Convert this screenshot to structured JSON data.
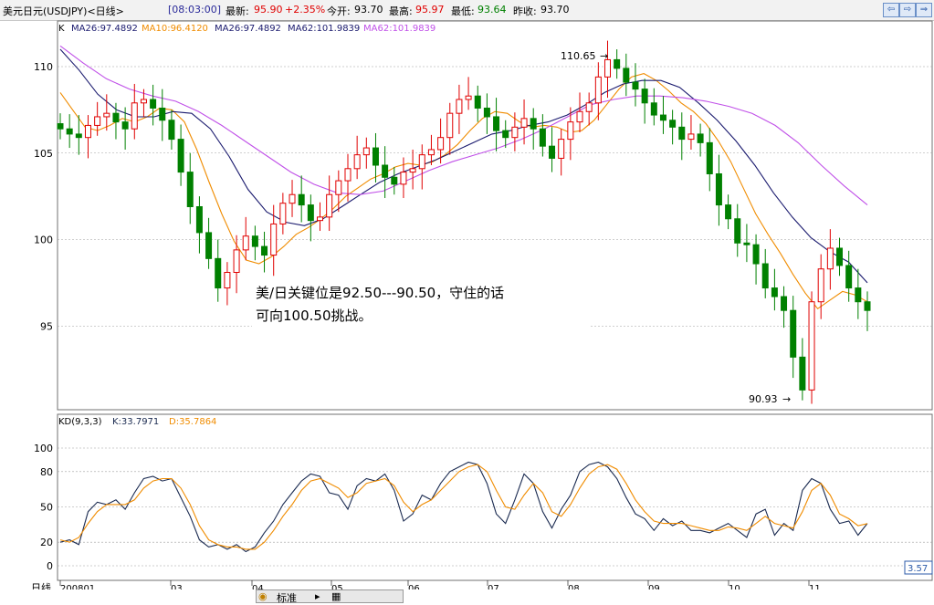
{
  "header": {
    "instrument": "美元日元(USDJPY)<日线>",
    "time": "[08:03:00]",
    "latest_label": "最新:",
    "latest_value": "95.90",
    "change_pct": "+2.35%",
    "open_label": "今开:",
    "open_value": "93.70",
    "high_label": "最高:",
    "high_value": "95.97",
    "low_label": "最低:",
    "low_value": "93.64",
    "prev_close_label": "昨收:",
    "prev_close_value": "93.70"
  },
  "main_legend": {
    "k": "K",
    "ma26_a": "MA26:97.4892",
    "ma10": "MA10:96.4120",
    "ma26_b": "MA26:97.4892",
    "ma62_a": "MA62:101.9839",
    "ma62_b": "MA62:101.9839"
  },
  "kd_legend": {
    "title": "KD(9,3,3)",
    "k": "K:33.7971",
    "d": "D:35.7864"
  },
  "annotation": {
    "line1": "美/日关键位是92.50---90.50，守住的话",
    "line2": "可向100.50挑战。"
  },
  "price_markers": {
    "high": "110.65",
    "low": "90.93"
  },
  "price_ticks": [
    "110",
    "105",
    "100",
    "95"
  ],
  "kd_ticks": [
    "100",
    "80",
    "50",
    "20",
    "0"
  ],
  "x_axis": {
    "label": "日线",
    "months": [
      "200801",
      "03",
      "04",
      "05",
      "06",
      "07",
      "08",
      "09",
      "10",
      "11"
    ]
  },
  "kd_readout": "3.57",
  "bottom": {
    "label": "标准"
  },
  "colors": {
    "up": "#e00000",
    "down": "#008000",
    "ma10": "#f08c00",
    "ma26": "#1a1a6e",
    "ma62": "#c050e8",
    "k": "#1a2a50",
    "d": "#f08c00",
    "grid": "#a0a0a0",
    "accent_blue": "#2b5aa8"
  },
  "icons": [
    "nav-left-icon",
    "nav-right-icon",
    "nav-forward-icon"
  ],
  "chart_data": {
    "type": "candlestick",
    "title": "美元日元(USDJPY)<日线>",
    "xlabel": "日线",
    "ylim": [
      91,
      112.5
    ],
    "x_ticks": [
      "200801",
      "03",
      "04",
      "05",
      "06",
      "07",
      "08",
      "09",
      "10",
      "11"
    ],
    "series": [
      {
        "name": "K",
        "kind": "ohlc_close_approx",
        "values": [
          106.4,
          106.1,
          105.9,
          106.6,
          107.1,
          107.3,
          106.8,
          106.4,
          107.9,
          108.1,
          107.6,
          106.9,
          105.8,
          103.9,
          101.9,
          100.4,
          98.9,
          97.2,
          98.1,
          99.4,
          100.2,
          99.6,
          99.1,
          100.9,
          102.1,
          102.6,
          102.0,
          101.1,
          101.3,
          102.6,
          103.4,
          104.1,
          104.9,
          105.3,
          104.3,
          103.6,
          103.2,
          103.9,
          104.1,
          104.9,
          105.2,
          105.9,
          107.3,
          108.1,
          108.3,
          107.6,
          107.1,
          106.3,
          105.9,
          106.5,
          107.0,
          106.4,
          105.4,
          104.7,
          105.8,
          106.8,
          107.4,
          107.9,
          109.4,
          110.4,
          109.9,
          109.1,
          108.7,
          107.9,
          107.2,
          106.9,
          106.5,
          105.8,
          106.1,
          105.6,
          103.8,
          102.0,
          101.2,
          99.8,
          99.7,
          98.6,
          97.2,
          96.7,
          95.9,
          93.2,
          91.3,
          96.4,
          98.3,
          99.5,
          98.5,
          97.2,
          96.4,
          95.9
        ]
      },
      {
        "name": "MA10",
        "values": [
          108.5,
          107.5,
          106.5,
          106.3,
          106.6,
          107.0,
          106.8,
          107.1,
          107.6,
          107.5,
          106.8,
          105.2,
          103.3,
          101.5,
          99.9,
          98.8,
          98.6,
          99.0,
          99.6,
          100.3,
          100.7,
          101.2,
          101.8,
          102.5,
          103.0,
          103.5,
          103.8,
          104.2,
          104.4,
          104.3,
          104.5,
          104.9,
          105.5,
          106.3,
          107.0,
          107.4,
          107.3,
          106.8,
          106.5,
          106.6,
          106.5,
          106.2,
          106.3,
          106.9,
          107.8,
          108.7,
          109.4,
          109.6,
          109.2,
          108.6,
          107.9,
          107.4,
          106.7,
          105.7,
          104.5,
          103.0,
          101.5,
          100.3,
          99.2,
          98.0,
          96.9,
          96.0,
          96.5,
          97.0,
          96.8,
          96.4
        ]
      },
      {
        "name": "MA26",
        "values": [
          111.0,
          109.8,
          108.4,
          107.5,
          107.1,
          107.1,
          107.4,
          107.3,
          106.4,
          104.8,
          102.9,
          101.6,
          101.0,
          100.8,
          101.2,
          101.9,
          102.6,
          103.3,
          103.8,
          104.2,
          104.6,
          105.1,
          105.6,
          106.1,
          106.3,
          106.6,
          106.8,
          107.2,
          107.8,
          108.5,
          109.0,
          109.2,
          109.2,
          108.8,
          107.9,
          106.9,
          105.7,
          104.3,
          102.7,
          101.3,
          100.1,
          99.3,
          98.7,
          97.5
        ]
      },
      {
        "name": "MA62",
        "values": [
          111.2,
          110.2,
          109.3,
          108.7,
          108.3,
          108.0,
          107.4,
          106.6,
          105.7,
          104.8,
          103.9,
          103.2,
          102.7,
          102.6,
          102.8,
          103.4,
          104.0,
          104.5,
          104.9,
          105.3,
          105.8,
          106.4,
          107.1,
          107.8,
          108.1,
          108.3,
          108.3,
          108.2,
          108.0,
          107.7,
          107.3,
          106.6,
          105.6,
          104.3,
          103.1,
          102.0
        ]
      },
      {
        "name": "KD-K",
        "values": [
          20,
          22,
          18,
          46,
          54,
          52,
          56,
          48,
          62,
          74,
          76,
          72,
          74,
          58,
          42,
          22,
          16,
          18,
          14,
          18,
          12,
          16,
          28,
          38,
          52,
          62,
          72,
          78,
          76,
          62,
          60,
          48,
          68,
          74,
          72,
          78,
          64,
          38,
          44,
          60,
          56,
          70,
          80,
          84,
          88,
          86,
          70,
          44,
          36,
          56,
          78,
          70,
          46,
          32,
          48,
          60,
          80,
          86,
          88,
          84,
          74,
          58,
          44,
          40,
          30,
          40,
          34,
          38,
          30,
          30,
          28,
          32,
          36,
          30,
          24,
          44,
          48,
          26,
          36,
          30,
          64,
          74,
          70,
          48,
          36,
          38,
          26,
          36
        ]
      },
      {
        "name": "KD-D",
        "values": [
          22,
          20,
          24,
          36,
          46,
          52,
          52,
          52,
          56,
          66,
          72,
          74,
          74,
          66,
          52,
          34,
          22,
          18,
          16,
          16,
          14,
          14,
          20,
          30,
          42,
          52,
          64,
          72,
          74,
          70,
          66,
          58,
          62,
          70,
          72,
          74,
          68,
          54,
          46,
          52,
          56,
          64,
          72,
          80,
          84,
          86,
          80,
          64,
          50,
          48,
          60,
          70,
          62,
          46,
          42,
          52,
          66,
          78,
          84,
          86,
          82,
          70,
          56,
          46,
          38,
          36,
          36,
          36,
          34,
          32,
          30,
          30,
          33,
          32,
          30,
          36,
          42,
          36,
          34,
          32,
          46,
          64,
          70,
          60,
          44,
          40,
          34,
          35.8
        ]
      }
    ]
  }
}
